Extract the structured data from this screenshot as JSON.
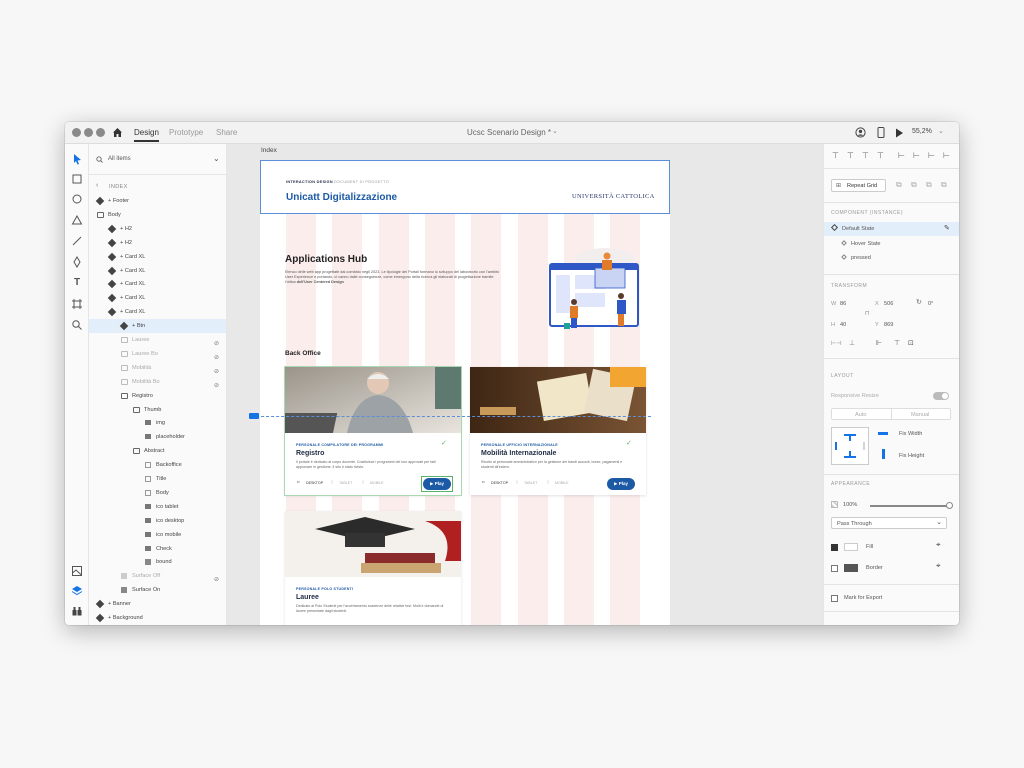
{
  "titlebar": {
    "tabs": [
      "Design",
      "Prototype",
      "Share"
    ],
    "doc_title": "Ucsc Scenario Design *",
    "zoom": "55,2%"
  },
  "layers": {
    "filter": "All items",
    "back": "INDEX",
    "items": [
      {
        "label": "+ Footer",
        "type": "component",
        "indent": 0
      },
      {
        "label": "Body",
        "type": "group",
        "indent": 0
      },
      {
        "label": "+ H2",
        "type": "component",
        "indent": 1
      },
      {
        "label": "+ H2",
        "type": "component",
        "indent": 1
      },
      {
        "label": "+ Card XL",
        "type": "component",
        "indent": 1
      },
      {
        "label": "+ Card XL",
        "type": "component",
        "indent": 1
      },
      {
        "label": "+ Card XL",
        "type": "component",
        "indent": 1
      },
      {
        "label": "+ Card XL",
        "type": "component",
        "indent": 1
      },
      {
        "label": "+ Card XL",
        "type": "component",
        "indent": 1
      },
      {
        "label": "+ Btn",
        "type": "component",
        "indent": 2,
        "selected": true
      },
      {
        "label": "Lauree",
        "type": "group",
        "indent": 2,
        "dim": true,
        "hidden": true
      },
      {
        "label": "Lauree Bo",
        "type": "group",
        "indent": 2,
        "dim": true,
        "hidden": true
      },
      {
        "label": "Mobilità",
        "type": "group",
        "indent": 2,
        "dim": true,
        "hidden": true
      },
      {
        "label": "Mobilità Bo",
        "type": "group",
        "indent": 2,
        "dim": true,
        "hidden": true
      },
      {
        "label": "Registro",
        "type": "group",
        "indent": 2
      },
      {
        "label": "Thumb",
        "type": "group",
        "indent": 3
      },
      {
        "label": "img",
        "type": "image",
        "indent": 4
      },
      {
        "label": "placeholder",
        "type": "image",
        "indent": 4
      },
      {
        "label": "Abstract",
        "type": "group",
        "indent": 3
      },
      {
        "label": "Backoffice",
        "type": "text",
        "indent": 4
      },
      {
        "label": "Title",
        "type": "text",
        "indent": 4
      },
      {
        "label": "Body",
        "type": "text",
        "indent": 4
      },
      {
        "label": "ico tablet",
        "type": "image",
        "indent": 4
      },
      {
        "label": "ico desktop",
        "type": "image",
        "indent": 4
      },
      {
        "label": "ico mobile",
        "type": "image",
        "indent": 4
      },
      {
        "label": "Check",
        "type": "image",
        "indent": 4
      },
      {
        "label": "bound",
        "type": "shape",
        "indent": 4
      },
      {
        "label": "Surface Off",
        "type": "shape",
        "indent": 2,
        "dim": true,
        "hidden": true
      },
      {
        "label": "Surface On",
        "type": "shape",
        "indent": 2
      },
      {
        "label": "+ Banner",
        "type": "component",
        "indent": 0
      },
      {
        "label": "+ Background",
        "type": "component",
        "indent": 0
      }
    ]
  },
  "canvas": {
    "artboard_label": "Index",
    "header": {
      "eyebrow_bold": "INTERACTION DESIGN",
      "eyebrow_light": "DOCUMENT DI PROGETTO",
      "title": "Unicatt Digitalizzazione",
      "logo": "UNIVERSITÀ CATTOLICA"
    },
    "hub": {
      "title": "Applications Hub",
      "desc": "Elenco delle web app progettate dal comitato negli 2023. Le tipologie dei Portali formano lo sviluppo del laboratorio con l'ambito User Experience e portando, ci vanno dalle conseguenze, come emergono della ricerca gli elaborati di progettazione tramite l'ottica",
      "desc_bold": "dell'User Centered Design"
    },
    "section_title": "Back Office",
    "cards": [
      {
        "tag": "PERSONALE COMPILATORE DEI PROGRAMMI",
        "title": "Registro",
        "desc": "Il portale è dedicato al corpo docente. Costituisce i programmi dei loro approvati per farli approvare in gestione. Il sito è stato rivisto.",
        "devices": [
          "DESKTOP",
          "TABLET",
          "MOBILE"
        ],
        "button": "Play"
      },
      {
        "tag": "PERSONALE UFFICIO INTERNAZIONALE",
        "title": "Mobilità Internazionale",
        "desc": "Rivolto al personale amministrativo per la gestione dei bandi accordi, borse, pagamenti e studenti all'estero.",
        "devices": [
          "DESKTOP",
          "TABLET",
          "MOBILE"
        ],
        "button": "Play"
      },
      {
        "tag": "PERSONALE POLO STUDENTI",
        "title": "Lauree",
        "desc": "Dedicato al Polo Studenti per l'accertamento scadenze delle relative tesi. Molti e domande di lauree presentate dagli studenti."
      }
    ]
  },
  "properties": {
    "repeat_grid": "Repeat Grid",
    "component_header": "COMPONENT (INSTANCE)",
    "states": [
      "Default State",
      "Hover State",
      "pressed"
    ],
    "transform_header": "TRANSFORM",
    "w": "86",
    "h": "40",
    "x": "506",
    "y": "869",
    "rotation": "0°",
    "layout_header": "LAYOUT",
    "responsive_resize": "Responsive Resize",
    "resize_options": [
      "Auto",
      "Manual"
    ],
    "fix_width": "Fix Width",
    "fix_height": "Fix Height",
    "appearance_header": "APPEARANCE",
    "opacity": "100%",
    "blend": "Pass Through",
    "fill": "Fill",
    "border": "Border",
    "mark_export": "Mark for Export"
  }
}
